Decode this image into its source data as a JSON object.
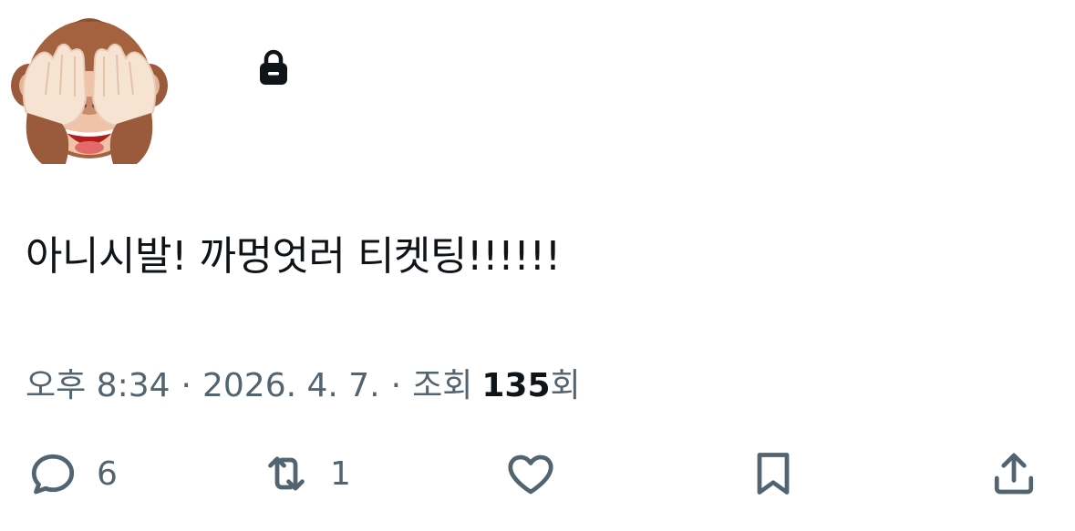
{
  "header": {
    "display_name": "",
    "handle": "",
    "protected_icon": "lock-icon",
    "avatar_emoji": "see-no-evil-monkey"
  },
  "tweet": {
    "text": "아니시발! 까멍엇러 티켓팅!!!!!!"
  },
  "meta": {
    "time": "오후 8:34",
    "separator": "·",
    "date": "2026. 4. 7.",
    "views_label": "조회",
    "views_count": "135",
    "views_suffix": "회"
  },
  "actions": {
    "reply_count": "6",
    "retweet_count": "1",
    "like_count": "",
    "bookmark_count": "",
    "icons": [
      "reply-icon",
      "retweet-icon",
      "heart-icon",
      "bookmark-icon",
      "share-icon"
    ]
  },
  "colors": {
    "text_primary": "#0f1419",
    "text_secondary": "#536471",
    "background": "#ffffff"
  }
}
